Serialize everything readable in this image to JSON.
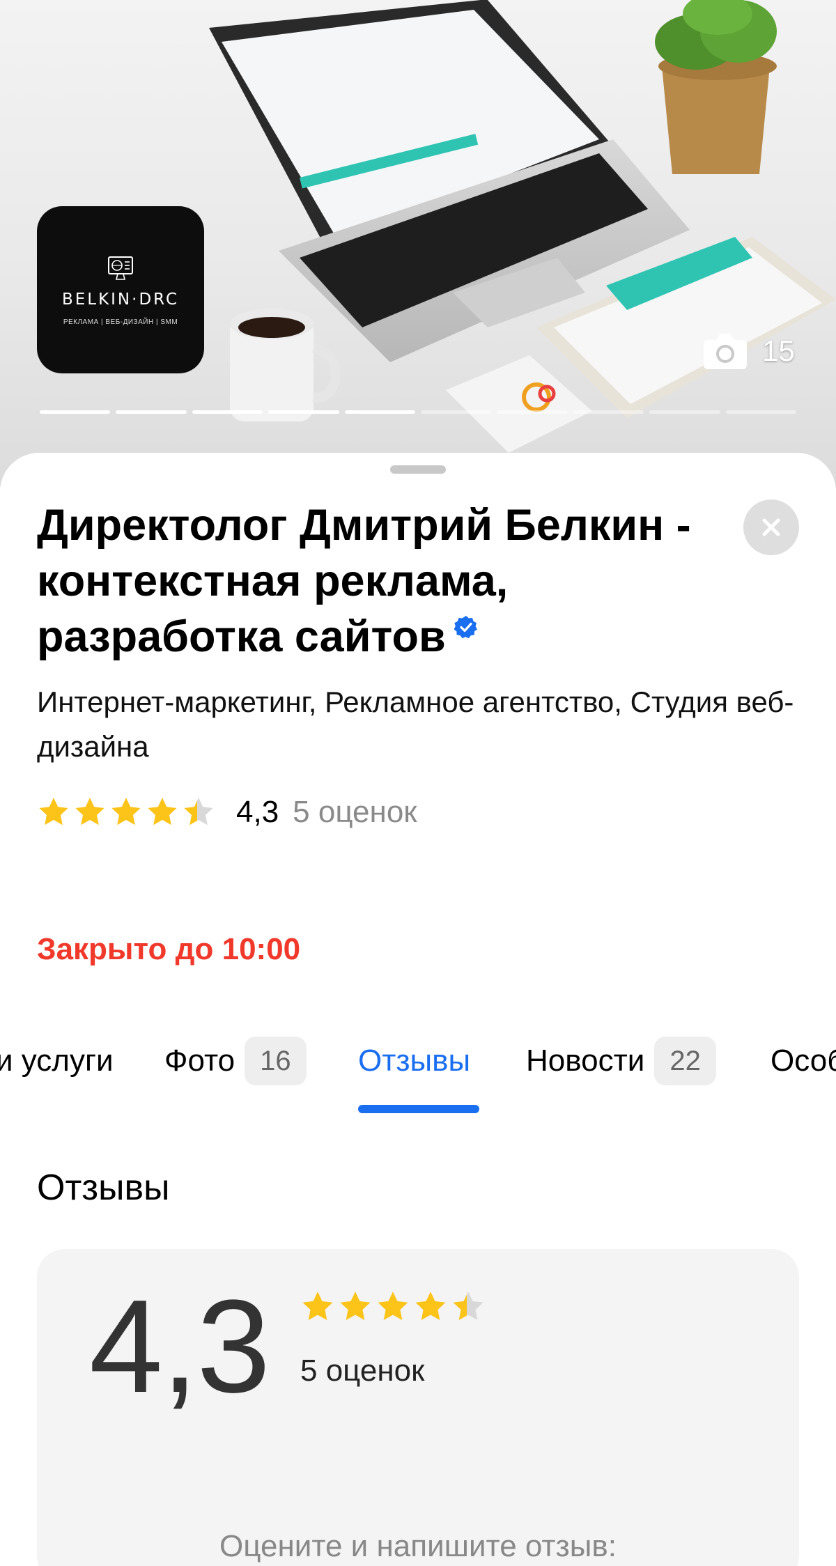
{
  "hero": {
    "logo": {
      "name": "BELKIN·DRC",
      "tagline": "РЕКЛАМА | ВЕБ-ДИЗАЙН | SMM"
    },
    "photo_count": "15",
    "progress": {
      "total": 10,
      "active": 5
    }
  },
  "business": {
    "title": "Директолог Дмитрий Белкин - контекстная реклама, разработка сайтов",
    "categories": "Интернет-маркетинг, Рекламное агентство, Студия веб-дизайна",
    "rating_value": "4,3",
    "rating_count": "5 оценок",
    "rating_stars": 4.3,
    "status": "Закрыто до 10:00"
  },
  "tabs": [
    {
      "label": "и услуги",
      "badge": ""
    },
    {
      "label": "Фото",
      "badge": "16"
    },
    {
      "label": "Отзывы",
      "badge": "",
      "active": true
    },
    {
      "label": "Новости",
      "badge": "22"
    },
    {
      "label": "Особ",
      "badge": ""
    }
  ],
  "reviews": {
    "heading": "Отзывы",
    "big_rating": "4,3",
    "count": "5 оценок",
    "prompt": "Оцените и напишите отзыв:"
  },
  "colors": {
    "accent_blue": "#1a6ef0",
    "star_yellow": "#fcc318",
    "status_red": "#f0392b",
    "verified_blue": "#1a6ef0"
  },
  "icons": {
    "camera": "camera-icon",
    "close": "close-icon",
    "verified": "verified-badge-icon",
    "star": "star-icon"
  }
}
